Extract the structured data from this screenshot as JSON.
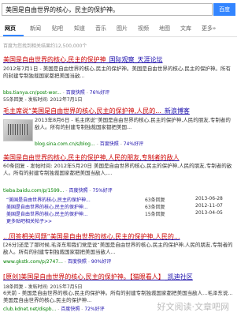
{
  "search": {
    "query": "美国是自由世界的核心，民主的保护神。",
    "button": "百度"
  },
  "tabs": [
    "网页",
    "新闻",
    "贴吧",
    "知道",
    "音乐",
    "图片",
    "视频",
    "地图",
    "文库",
    "更多»"
  ],
  "result_count": "百度为您找到相关结果约12,500,000个",
  "results": [
    {
      "title_hl": "美国是自由世界的核心,民主的保护神",
      "title_rest": "_国际观察_天涯论坛",
      "snippet": "2012年7月1日 - 美国是自由世界的核心,民主的保护神。美国是自由世界的核心,民主的保护神。所有的封建专制独裁国家都把美国当敌...",
      "source": "bbs.tianya.cn/post-wor...",
      "cache": "百度快照",
      "rating": "76%好评",
      "sub_meta": "55条回复 - 发帖时间: 2012年7月1日"
    },
    {
      "title_hl": "毛主席说“美国是自由世界的核心,民主的保护神,人民的...",
      "title_rest": "_新浪博客",
      "snippet": "2013年8月6日 - 毛主席说“美国是自由世界的核心,民主的保护神,人民的朋友,专制者的敌人。所有的封建专制独裁国家都把美国...",
      "source": "blog.sina.com.cn/s/blog...",
      "cache": "百度快照",
      "rating": "74%好评"
    },
    {
      "title_hl": "美国是自由世界的核心,民主的保护神,人民的朋友,专制者的敌人",
      "title_rest": "",
      "snippet": "60条回复 - 发帖时间: 2012年5月20日 美国是自由世界的核心,民主的保护神,人民的朋友,专制者的敌人。所有的封建专制独裁国家都把美国当敌人,...",
      "source": "tieba.baidu.com/p/1599...",
      "cache": "百度快照",
      "rating": "75%好评",
      "subs": [
        {
          "text": "“美国是自由世界的核心,民主的保护神...",
          "replies": "63条回复",
          "date": "2013-06-28"
        },
        {
          "text": "美国是自由世界的核心,民主的保护神...",
          "replies": "63条回复",
          "date": "2012-11-07"
        },
        {
          "text": "美国是自由世界的核心,民主的保护神...",
          "replies": "15条回复",
          "date": "2013-04-05"
        }
      ],
      "more": "更多贴吧相关帖子>>"
    },
    {
      "title_hl": "...回答相关问题“美国是自由世界的核心,民主的保护神,人民的...",
      "title_rest": "",
      "snippet": "[26分]还是了那时候,毛泽东和我们党是说“美国是自由世界的核心,民主的保护神,人民的朋友,专制者的敌人。所有的封建专制独裁国家都把美国当敌人...",
      "source": "www.gkstk.com/p/2747...",
      "cache": "百度快照",
      "rating": "90%好评"
    },
    {
      "title_hl": "[原创]美国是自由世界的核心,民主的保护神。【猫眼看人】",
      "title_rest": "_凯迪社区",
      "snippet": "6天前 - 美国是自由世界的核心,民主的保护神。所有的封建专制独裁国家都把美国当敌人...毛泽东说...美国是自由世界的核心,民主的保护神...",
      "source": "club.kdnet.net/dispb...",
      "cache": "百度快照",
      "rating": "72%好评",
      "sub_meta": "18条回复 - 发帖时间: 2015年7月5日"
    }
  ],
  "watermark": "好文阅读·文章吧网"
}
